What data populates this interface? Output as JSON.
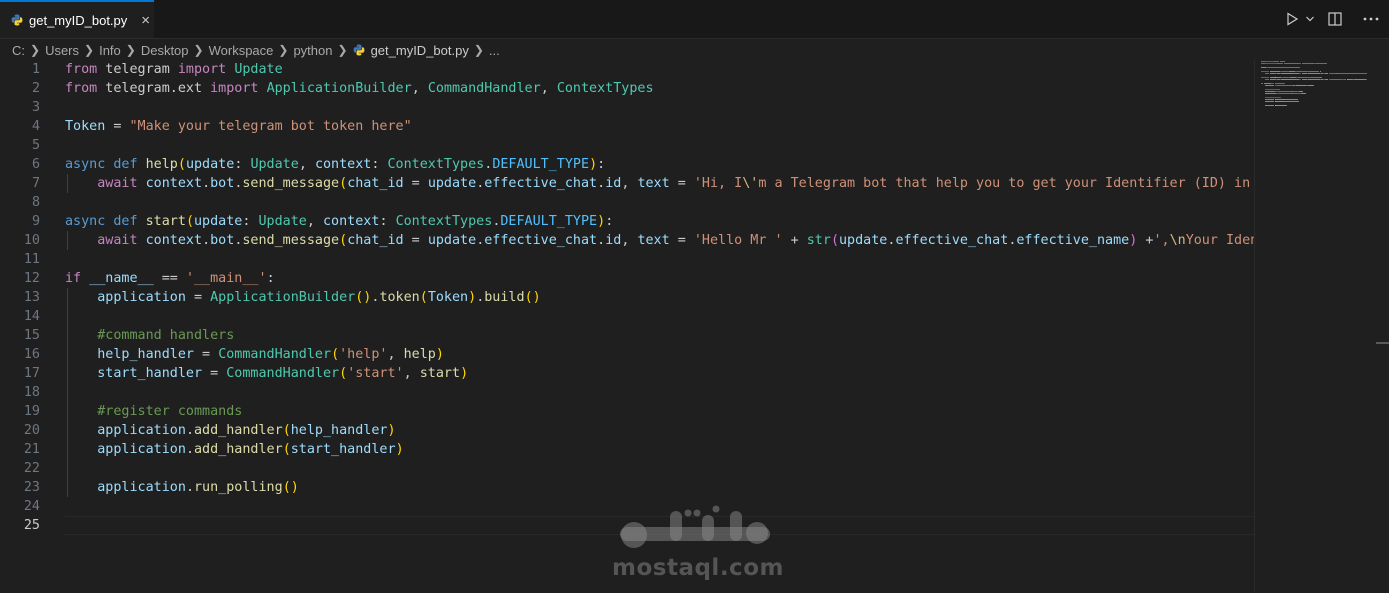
{
  "tab": {
    "filename": "get_myID_bot.py",
    "close": "×"
  },
  "breadcrumb": {
    "parts": [
      "C:",
      "Users",
      "Info",
      "Desktop",
      "Workspace",
      "python"
    ],
    "file": "get_myID_bot.py",
    "more": "..."
  },
  "editor": {
    "active_line": 25,
    "lines": [
      {
        "n": "1",
        "tokens": [
          [
            "kw",
            "from"
          ],
          [
            "t",
            " telegram "
          ],
          [
            "kw",
            "import"
          ],
          [
            "t",
            " "
          ],
          [
            "cls",
            "Update"
          ]
        ]
      },
      {
        "n": "2",
        "tokens": [
          [
            "kw",
            "from"
          ],
          [
            "t",
            " telegram.ext "
          ],
          [
            "kw",
            "import"
          ],
          [
            "t",
            " "
          ],
          [
            "cls",
            "ApplicationBuilder"
          ],
          [
            "t",
            ", "
          ],
          [
            "cls",
            "CommandHandler"
          ],
          [
            "t",
            ", "
          ],
          [
            "cls",
            "ContextTypes"
          ]
        ]
      },
      {
        "n": "3",
        "tokens": []
      },
      {
        "n": "4",
        "tokens": [
          [
            "var",
            "Token"
          ],
          [
            "t",
            " = "
          ],
          [
            "str",
            "\"Make your telegram bot token here\""
          ]
        ]
      },
      {
        "n": "5",
        "tokens": []
      },
      {
        "n": "6",
        "tokens": [
          [
            "kwb",
            "async"
          ],
          [
            "t",
            " "
          ],
          [
            "kwb",
            "def"
          ],
          [
            "t",
            " "
          ],
          [
            "fn",
            "help"
          ],
          [
            "p1",
            "("
          ],
          [
            "var",
            "update"
          ],
          [
            "t",
            ": "
          ],
          [
            "cls",
            "Update"
          ],
          [
            "t",
            ", "
          ],
          [
            "var",
            "context"
          ],
          [
            "t",
            ": "
          ],
          [
            "cls",
            "ContextTypes"
          ],
          [
            "t",
            "."
          ],
          [
            "cst",
            "DEFAULT_TYPE"
          ],
          [
            "p1",
            ")"
          ],
          [
            "t",
            ":"
          ]
        ]
      },
      {
        "n": "7",
        "tokens": [
          [
            "t",
            "    "
          ],
          [
            "kw",
            "await"
          ],
          [
            "t",
            " "
          ],
          [
            "var",
            "context"
          ],
          [
            "t",
            "."
          ],
          [
            "var",
            "bot"
          ],
          [
            "t",
            "."
          ],
          [
            "fn",
            "send_message"
          ],
          [
            "p1",
            "("
          ],
          [
            "var",
            "chat_id"
          ],
          [
            "t",
            " = "
          ],
          [
            "var",
            "update"
          ],
          [
            "t",
            "."
          ],
          [
            "var",
            "effective_chat"
          ],
          [
            "t",
            "."
          ],
          [
            "var",
            "id"
          ],
          [
            "t",
            ", "
          ],
          [
            "var",
            "text"
          ],
          [
            "t",
            " = "
          ],
          [
            "str",
            "'Hi, I"
          ],
          [
            "esc",
            "\\'"
          ],
          [
            "str",
            "m a Telegram bot that help you to get your Identifier (ID) in telegram"
          ]
        ]
      },
      {
        "n": "8",
        "tokens": []
      },
      {
        "n": "9",
        "tokens": [
          [
            "kwb",
            "async"
          ],
          [
            "t",
            " "
          ],
          [
            "kwb",
            "def"
          ],
          [
            "t",
            " "
          ],
          [
            "fn",
            "start"
          ],
          [
            "p1",
            "("
          ],
          [
            "var",
            "update"
          ],
          [
            "t",
            ": "
          ],
          [
            "cls",
            "Update"
          ],
          [
            "t",
            ", "
          ],
          [
            "var",
            "context"
          ],
          [
            "t",
            ": "
          ],
          [
            "cls",
            "ContextTypes"
          ],
          [
            "t",
            "."
          ],
          [
            "cst",
            "DEFAULT_TYPE"
          ],
          [
            "p1",
            ")"
          ],
          [
            "t",
            ":"
          ]
        ]
      },
      {
        "n": "10",
        "tokens": [
          [
            "t",
            "    "
          ],
          [
            "kw",
            "await"
          ],
          [
            "t",
            " "
          ],
          [
            "var",
            "context"
          ],
          [
            "t",
            "."
          ],
          [
            "var",
            "bot"
          ],
          [
            "t",
            "."
          ],
          [
            "fn",
            "send_message"
          ],
          [
            "p1",
            "("
          ],
          [
            "var",
            "chat_id"
          ],
          [
            "t",
            " = "
          ],
          [
            "var",
            "update"
          ],
          [
            "t",
            "."
          ],
          [
            "var",
            "effective_chat"
          ],
          [
            "t",
            "."
          ],
          [
            "var",
            "id"
          ],
          [
            "t",
            ", "
          ],
          [
            "var",
            "text"
          ],
          [
            "t",
            " = "
          ],
          [
            "str",
            "'Hello Mr '"
          ],
          [
            "t",
            " + "
          ],
          [
            "cls",
            "str"
          ],
          [
            "p2",
            "("
          ],
          [
            "var",
            "update"
          ],
          [
            "t",
            "."
          ],
          [
            "var",
            "effective_chat"
          ],
          [
            "t",
            "."
          ],
          [
            "var",
            "effective_name"
          ],
          [
            "p2",
            ")"
          ],
          [
            "t",
            " +"
          ],
          [
            "str",
            "',"
          ],
          [
            "esc",
            "\\n"
          ],
          [
            "str",
            "Your Identifier is "
          ]
        ]
      },
      {
        "n": "11",
        "tokens": []
      },
      {
        "n": "12",
        "tokens": [
          [
            "kw",
            "if"
          ],
          [
            "t",
            " "
          ],
          [
            "var",
            "__name__"
          ],
          [
            "t",
            " == "
          ],
          [
            "str",
            "'__main__'"
          ],
          [
            "t",
            ":"
          ]
        ]
      },
      {
        "n": "13",
        "tokens": [
          [
            "t",
            "    "
          ],
          [
            "var",
            "application"
          ],
          [
            "t",
            " = "
          ],
          [
            "cls",
            "ApplicationBuilder"
          ],
          [
            "p1",
            "()"
          ],
          [
            "t",
            "."
          ],
          [
            "fn",
            "token"
          ],
          [
            "p1",
            "("
          ],
          [
            "var",
            "Token"
          ],
          [
            "p1",
            ")"
          ],
          [
            "t",
            "."
          ],
          [
            "fn",
            "build"
          ],
          [
            "p1",
            "()"
          ]
        ]
      },
      {
        "n": "14",
        "tokens": []
      },
      {
        "n": "15",
        "tokens": [
          [
            "t",
            "    "
          ],
          [
            "cmt",
            "#command handlers"
          ]
        ]
      },
      {
        "n": "16",
        "tokens": [
          [
            "t",
            "    "
          ],
          [
            "var",
            "help_handler"
          ],
          [
            "t",
            " = "
          ],
          [
            "cls",
            "CommandHandler"
          ],
          [
            "p1",
            "("
          ],
          [
            "str",
            "'help'"
          ],
          [
            "t",
            ", "
          ],
          [
            "fn",
            "help"
          ],
          [
            "p1",
            ")"
          ]
        ]
      },
      {
        "n": "17",
        "tokens": [
          [
            "t",
            "    "
          ],
          [
            "var",
            "start_handler"
          ],
          [
            "t",
            " = "
          ],
          [
            "cls",
            "CommandHandler"
          ],
          [
            "p1",
            "("
          ],
          [
            "str",
            "'start'"
          ],
          [
            "t",
            ", "
          ],
          [
            "fn",
            "start"
          ],
          [
            "p1",
            ")"
          ]
        ]
      },
      {
        "n": "18",
        "tokens": []
      },
      {
        "n": "19",
        "tokens": [
          [
            "t",
            "    "
          ],
          [
            "cmt",
            "#register commands"
          ]
        ]
      },
      {
        "n": "20",
        "tokens": [
          [
            "t",
            "    "
          ],
          [
            "var",
            "application"
          ],
          [
            "t",
            "."
          ],
          [
            "fn",
            "add_handler"
          ],
          [
            "p1",
            "("
          ],
          [
            "var",
            "help_handler"
          ],
          [
            "p1",
            ")"
          ]
        ]
      },
      {
        "n": "21",
        "tokens": [
          [
            "t",
            "    "
          ],
          [
            "var",
            "application"
          ],
          [
            "t",
            "."
          ],
          [
            "fn",
            "add_handler"
          ],
          [
            "p1",
            "("
          ],
          [
            "var",
            "start_handler"
          ],
          [
            "p1",
            ")"
          ]
        ]
      },
      {
        "n": "22",
        "tokens": []
      },
      {
        "n": "23",
        "tokens": [
          [
            "t",
            "    "
          ],
          [
            "var",
            "application"
          ],
          [
            "t",
            "."
          ],
          [
            "fn",
            "run_polling"
          ],
          [
            "p1",
            "()"
          ]
        ]
      },
      {
        "n": "24",
        "tokens": []
      },
      {
        "n": "25",
        "tokens": []
      }
    ]
  },
  "watermark": {
    "text": "mostaql.com",
    "arabic": "مستقل"
  },
  "icons": {
    "file": "python-file-icon",
    "run": "play-icon",
    "run_menu": "chevron-down-icon",
    "split": "split-editor-icon",
    "more": "ellipsis-icon"
  },
  "colors": {
    "editor_bg": "#1f1f1f",
    "tab_accent": "#0078d4",
    "keyword": "#c586c0",
    "string": "#ce9178",
    "class": "#4ec9b0",
    "function": "#dcdcaa",
    "variable": "#9cdcfe",
    "comment": "#6a9955"
  }
}
